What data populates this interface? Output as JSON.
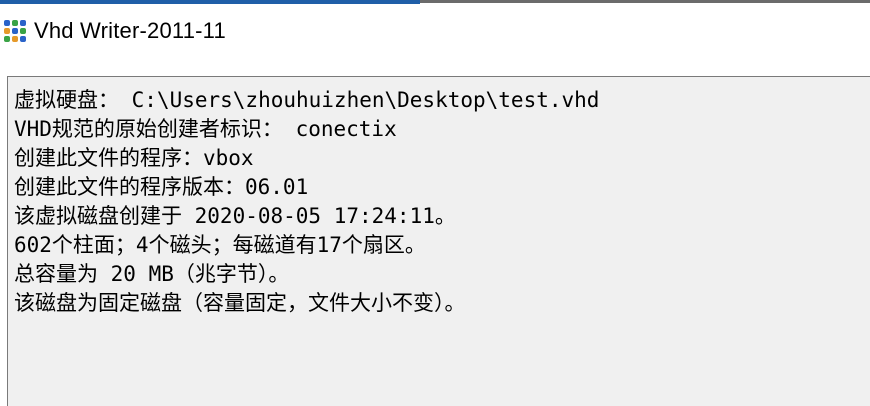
{
  "window": {
    "title": "Vhd Writer-2011-11",
    "icon": "grid-app-icon"
  },
  "info": {
    "lines": [
      "虚拟硬盘： C:\\Users\\zhouhuizhen\\Desktop\\test.vhd",
      "VHD规范的原始创建者标识： conectix",
      "创建此文件的程序：vbox",
      "创建此文件的程序版本：06.01",
      "该虚拟磁盘创建于 2020-08-05 17:24:11。",
      "602个柱面；4个磁头；每磁道有17个扇区。",
      "总容量为 20 MB（兆字节）。",
      "该磁盘为固定磁盘（容量固定，文件大小不变）。"
    ]
  },
  "colors": {
    "panel_background": "#f0f0f0",
    "text": "#000000",
    "icon_blue": "#2a63c9",
    "icon_green": "#3aa346",
    "icon_orange": "#e69a2a"
  }
}
